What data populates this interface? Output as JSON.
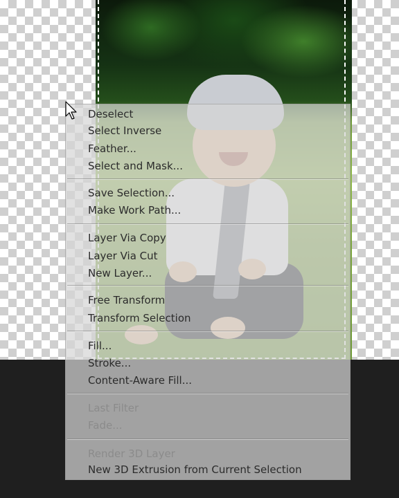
{
  "context_menu": {
    "groups": [
      {
        "items": [
          {
            "label": "Deselect",
            "enabled": true
          },
          {
            "label": "Select Inverse",
            "enabled": true
          },
          {
            "label": "Feather...",
            "enabled": true
          },
          {
            "label": "Select and Mask...",
            "enabled": true
          }
        ]
      },
      {
        "items": [
          {
            "label": "Save Selection...",
            "enabled": true
          },
          {
            "label": "Make Work Path...",
            "enabled": true
          }
        ]
      },
      {
        "items": [
          {
            "label": "Layer Via Copy",
            "enabled": true
          },
          {
            "label": "Layer Via Cut",
            "enabled": true
          },
          {
            "label": "New Layer...",
            "enabled": true
          }
        ]
      },
      {
        "items": [
          {
            "label": "Free Transform",
            "enabled": true
          },
          {
            "label": "Transform Selection",
            "enabled": true
          }
        ]
      },
      {
        "items": [
          {
            "label": "Fill...",
            "enabled": true
          },
          {
            "label": "Stroke...",
            "enabled": true
          },
          {
            "label": "Content-Aware Fill...",
            "enabled": true
          }
        ]
      },
      {
        "items": [
          {
            "label": "Last Filter",
            "enabled": false
          },
          {
            "label": "Fade...",
            "enabled": false
          }
        ]
      },
      {
        "items": [
          {
            "label": "Render 3D Layer",
            "enabled": false
          },
          {
            "label": "New 3D Extrusion from Current Selection",
            "enabled": true
          }
        ]
      }
    ]
  },
  "canvas": {
    "icons": [
      "arrow-cursor-icon"
    ],
    "colors": {
      "pasteboard": "#1f1f1f",
      "menu_text": "#2b2b2b",
      "menu_text_disabled": "#8b8b8b"
    }
  }
}
